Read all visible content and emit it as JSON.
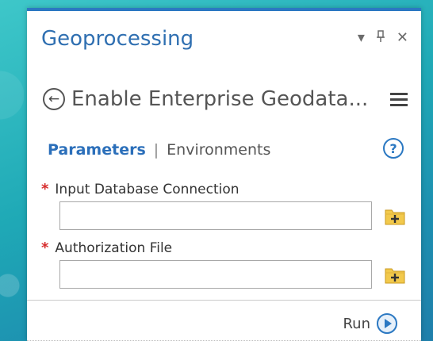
{
  "pane": {
    "title": "Geoprocessing",
    "controls": {
      "dropdown_glyph": "▾",
      "pin_glyph": "ᵠ",
      "close_glyph": "✕"
    }
  },
  "tool": {
    "title": "Enable Enterprise Geodata...",
    "back_glyph": "←"
  },
  "tabs": {
    "parameters": "Parameters",
    "separator": "|",
    "environments": "Environments"
  },
  "help_glyph": "?",
  "fields": [
    {
      "required_mark": "*",
      "label": "Input Database Connection",
      "value": ""
    },
    {
      "required_mark": "*",
      "label": "Authorization File",
      "value": ""
    }
  ],
  "run": {
    "label": "Run"
  },
  "colors": {
    "accent": "#2b78c2",
    "required": "#d62b2b",
    "folder": "#f2c94c"
  }
}
